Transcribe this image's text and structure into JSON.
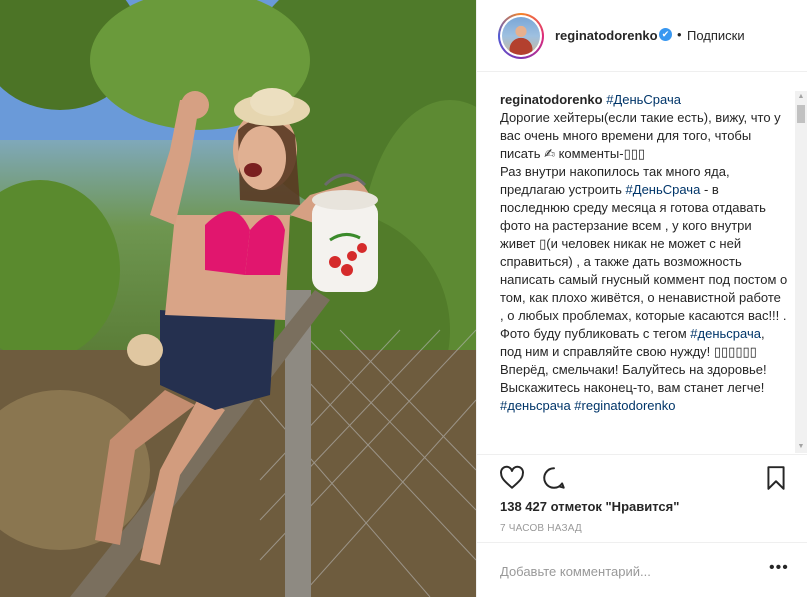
{
  "header": {
    "username": "reginatodorenko",
    "verified_mark": "✔",
    "separator": "•",
    "follow_label": "Подписки"
  },
  "caption": {
    "author": "reginatodorenko",
    "hashtag1": "#ДеньСрача",
    "line1": "Дорогие хейтеры(если такие есть), вижу, что у вас очень много времени для того, чтобы писать ✍ комменты-▯▯▯",
    "line2a": "Раз внутри накопилось так много яда, предлагаю устроить ",
    "hashtag2": "#ДеньСрача",
    "line2b": " - в последнюю среду месяца я готова отдавать фото на растерзание всем , у кого внутри живет ▯(и человек никак не может с ней справиться) , а также дать возможность написать самый гнусный коммент под постом о том, как плохо живётся, о ненавистной работе , о любых проблемах, которые касаются вас!!! .",
    "line3a": "Фото буду публиковать с тегом ",
    "hashtag3": "#деньсрача",
    "line3b": ", под ним и справляйте свою нужду! ▯▯▯▯▯▯",
    "line4": "Вперёд, смельчаки! Балуйтесь на здоровье! Выскажитесь наконец-то, вам станет легче!",
    "line5": "#деньсрача #reginatodorenko"
  },
  "scroll": {
    "up": "▲",
    "down": "▼"
  },
  "actions": {
    "likes_text": "138 427 отметок \"Нравится\"",
    "time_text": "7 ЧАСОВ НАЗАД"
  },
  "add_comment": {
    "placeholder": "Добавьте комментарий...",
    "more": "•••"
  },
  "icons": [
    "heart-icon",
    "comment-bubble-icon",
    "bookmark-icon",
    "verified-badge-icon"
  ],
  "colors": {
    "link": "#003569",
    "verified": "#3897f0",
    "muted": "#999999"
  }
}
